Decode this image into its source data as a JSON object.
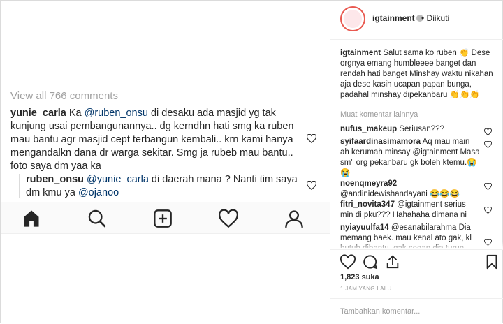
{
  "photo": {
    "view_all": "View all 766 comments",
    "comment1": {
      "user": "yunie_carla",
      "pre": " Ka ",
      "mention": "@ruben_onsu",
      "text": "  di desaku ada masjid yg tak kunjung usai pembangunannya.. dg kerndhn hati smg ka ruben mau bantu agr masjid cept terbangun kembali.. krn kami hanya mengandalkn dana dr warga sekitar. Smg ja rubeb mau bantu.. foto saya dm yaa ka"
    },
    "reply": {
      "user": "ruben_onsu",
      "mention": "@yunie_carla",
      "text": " di daerah mana ? Nanti tim saya dm kmu ya ",
      "mention2": "@ojanoo"
    }
  },
  "post": {
    "username": "igtainment",
    "follow_status": "• Diikuti",
    "caption_user": "igtainment",
    "caption_text": " Salut sama ko ruben 👏 Dese orgnya emang humbleeee banget dan rendah hati banget Minshay waktu nikahan aja dese kasih ucapan papan bunga, padahal minshay dipekanbaru 👏👏👏",
    "load_more": "Muat komentar lainnya",
    "comments": [
      {
        "user": "nufus_makeup",
        "text": " Seriusan???"
      },
      {
        "user": "syifaardinasimamora",
        "text": " Aq mau main ah kerumah minsay @igtainment Masa sm\" org pekanbaru gk boleh ktemu.😭 😭"
      },
      {
        "user": "noenqmeyra92",
        "text": " @andinidewishandayani 😂😂😂"
      },
      {
        "user": "fitri_novita347",
        "text": " @igtainment serius min di pku??? Hahahaha dimana ni"
      },
      {
        "user": "nyiayuulfa14",
        "text": " @esanabilarahma Dia memang baek. mau kenal ato gak, kl butuh dibantu, gak segan dia turun"
      }
    ],
    "likes": "1,823 suka",
    "time": "1 JAM YANG LALU",
    "add_comment_placeholder": "Tambahkan komentar..."
  },
  "colors": {
    "mention": "#003569",
    "story_ring": "#e95950",
    "muted": "#999999"
  }
}
